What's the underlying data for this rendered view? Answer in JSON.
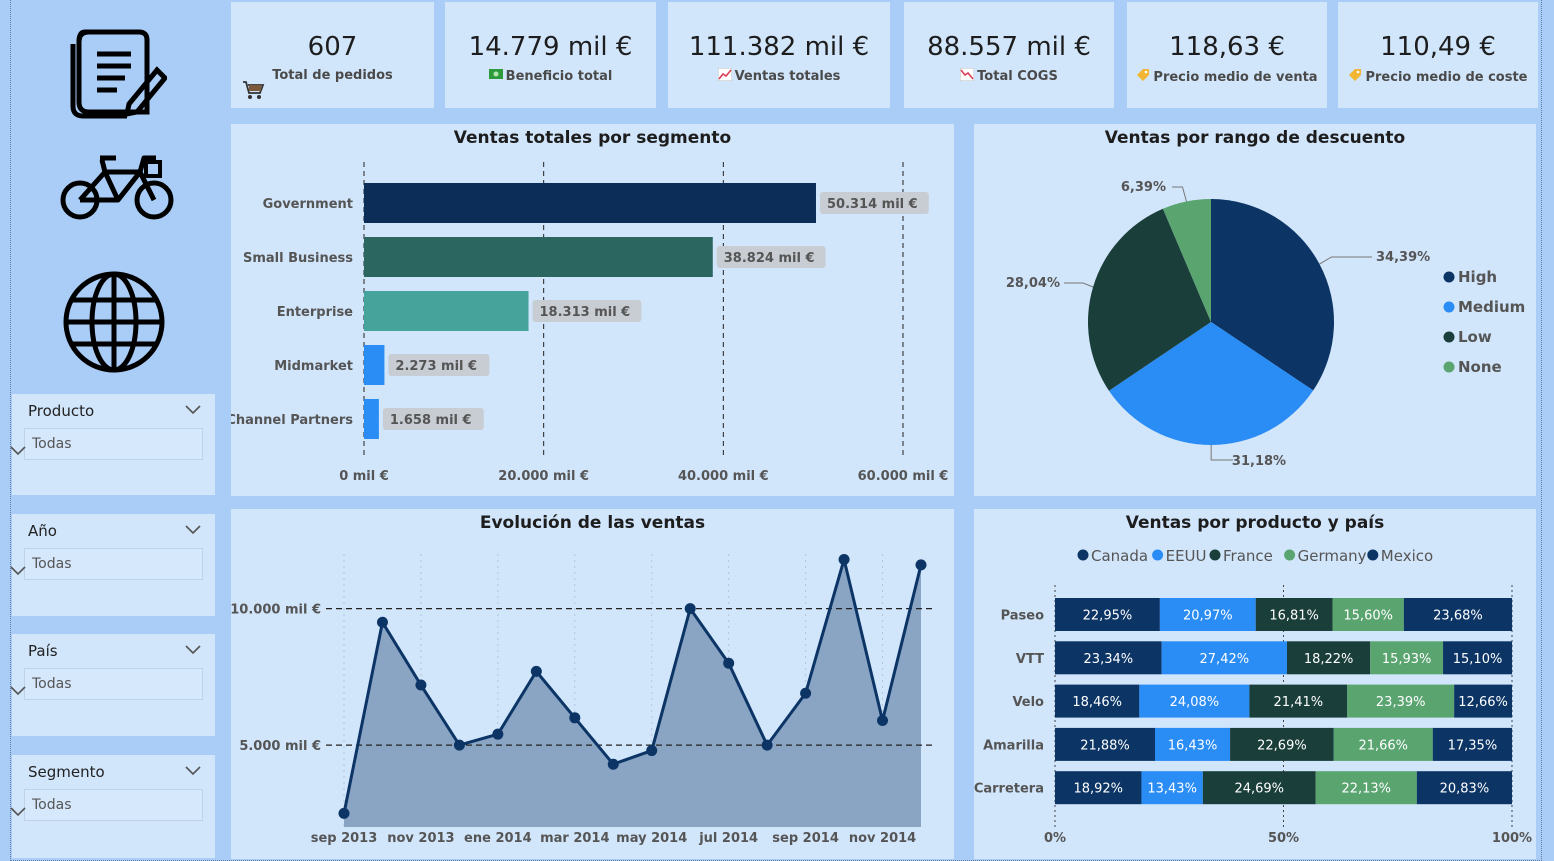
{
  "kpis": [
    {
      "value": "607",
      "label": "Total de pedidos",
      "icon": "shopping-cart-icon"
    },
    {
      "value": "14.779 mil €",
      "label": "Beneficio total",
      "icon": "money-icon"
    },
    {
      "value": "111.382 mil €",
      "label": "Ventas totales",
      "icon": "chart-increasing-icon"
    },
    {
      "value": "88.557 mil €",
      "label": "Total COGS",
      "icon": "chart-decreasing-icon"
    },
    {
      "value": "118,63 €",
      "label": "Precio medio de venta",
      "icon": "price-tag-icon"
    },
    {
      "value": "110,49 €",
      "label": "Precio medio de coste",
      "icon": "price-tag-icon"
    }
  ],
  "slicers": [
    {
      "title": "Producto",
      "value": "Todas"
    },
    {
      "title": "Año",
      "value": "Todas"
    },
    {
      "title": "País",
      "value": "Todas"
    },
    {
      "title": "Segmento",
      "value": "Todas"
    }
  ],
  "colors": {
    "page": "#a9cdf7",
    "panel": "#d1e5fb",
    "navy": "#0c2d57",
    "blue": "#2a8cf5",
    "darkgreen": "#1a3e3a",
    "green": "#5aa470",
    "teal": "#45a39c",
    "slate": "#2b6660"
  },
  "chart_data": [
    {
      "type": "bar",
      "title": "Ventas totales por segmento",
      "orientation": "horizontal",
      "categories": [
        "Government",
        "Small Business",
        "Enterprise",
        "Midmarket",
        "Channel Partners"
      ],
      "values": [
        50314,
        38824,
        18313,
        2273,
        1658
      ],
      "data_labels": [
        "50.314 mil €",
        "38.824 mil €",
        "18.313 mil €",
        "2.273 mil €",
        "1.658 mil €"
      ],
      "bar_colors": [
        "#0c2d57",
        "#2b6660",
        "#45a39c",
        "#2a8cf5",
        "#2a8cf5"
      ],
      "xlim": [
        0,
        60000
      ],
      "xticks": [
        0,
        20000,
        40000,
        60000
      ],
      "xtick_labels": [
        "0 mil €",
        "20.000 mil €",
        "40.000 mil €",
        "60.000 mil €"
      ],
      "grid": true
    },
    {
      "type": "pie",
      "title": "Ventas por rango de descuento",
      "labels": [
        "High",
        "Medium",
        "Low",
        "None"
      ],
      "values": [
        34.39,
        31.18,
        28.04,
        6.39
      ],
      "data_labels": [
        "34,39%",
        "31,18%",
        "28,04%",
        "6,39%"
      ],
      "colors": [
        "#0c3566",
        "#2a8cf5",
        "#1a3e3a",
        "#5aa470"
      ],
      "legend": "right"
    },
    {
      "type": "area",
      "title": "Evolución de las ventas",
      "x": [
        "sep 2013",
        "oct 2013",
        "nov 2013",
        "dic 2013",
        "ene 2014",
        "feb 2014",
        "mar 2014",
        "abr 2014",
        "may 2014",
        "jun 2014",
        "jul 2014",
        "ago 2014",
        "sep 2014",
        "oct 2014",
        "nov 2014",
        "dic 2014"
      ],
      "values": [
        2500,
        9500,
        7200,
        5000,
        5400,
        7700,
        6000,
        4300,
        4800,
        10000,
        8000,
        5000,
        6900,
        11800,
        5900,
        11600
      ],
      "xtick_labels": [
        "sep 2013",
        "nov 2013",
        "ene 2014",
        "mar 2014",
        "may 2014",
        "jul 2014",
        "sep 2014",
        "nov 2014"
      ],
      "yticks": [
        5000,
        10000
      ],
      "ytick_labels": [
        "5.000 mil €",
        "10.000 mil €"
      ],
      "ylim": [
        2000,
        12000
      ]
    },
    {
      "type": "bar",
      "stacked": "100%",
      "orientation": "horizontal",
      "title": "Ventas por producto y país",
      "categories": [
        "Paseo",
        "VTT",
        "Velo",
        "Amarilla",
        "Carretera"
      ],
      "series": [
        {
          "name": "Canada",
          "color": "#0c3566",
          "values": [
            22.95,
            23.34,
            18.46,
            21.88,
            18.92
          ],
          "labels": [
            "22,95%",
            "23,34%",
            "18,46%",
            "21,88%",
            "18,92%"
          ]
        },
        {
          "name": "EEUU",
          "color": "#2a8cf5",
          "values": [
            20.97,
            27.42,
            24.08,
            16.43,
            13.43
          ],
          "labels": [
            "20,97%",
            "27,42%",
            "24,08%",
            "16,43%",
            "13,43%"
          ]
        },
        {
          "name": "France",
          "color": "#1a3e3a",
          "values": [
            16.81,
            18.22,
            21.41,
            22.69,
            24.69
          ],
          "labels": [
            "16,81%",
            "18,22%",
            "21,41%",
            "22,69%",
            "24,69%"
          ]
        },
        {
          "name": "Germany",
          "color": "#5aa470",
          "values": [
            15.6,
            15.93,
            23.39,
            21.66,
            22.13
          ],
          "labels": [
            "15,60%",
            "15,93%",
            "23,39%",
            "21,66%",
            "22,13%"
          ]
        },
        {
          "name": "Mexico",
          "color": "#0c3566",
          "values": [
            23.68,
            15.1,
            12.66,
            17.35,
            20.83
          ],
          "labels": [
            "23,68%",
            "15,10%",
            "12,66%",
            "17,35%",
            "20,83%"
          ]
        }
      ],
      "xticks": [
        0,
        50,
        100
      ],
      "xtick_labels": [
        "0%",
        "50%",
        "100%"
      ],
      "legend": "top"
    }
  ]
}
